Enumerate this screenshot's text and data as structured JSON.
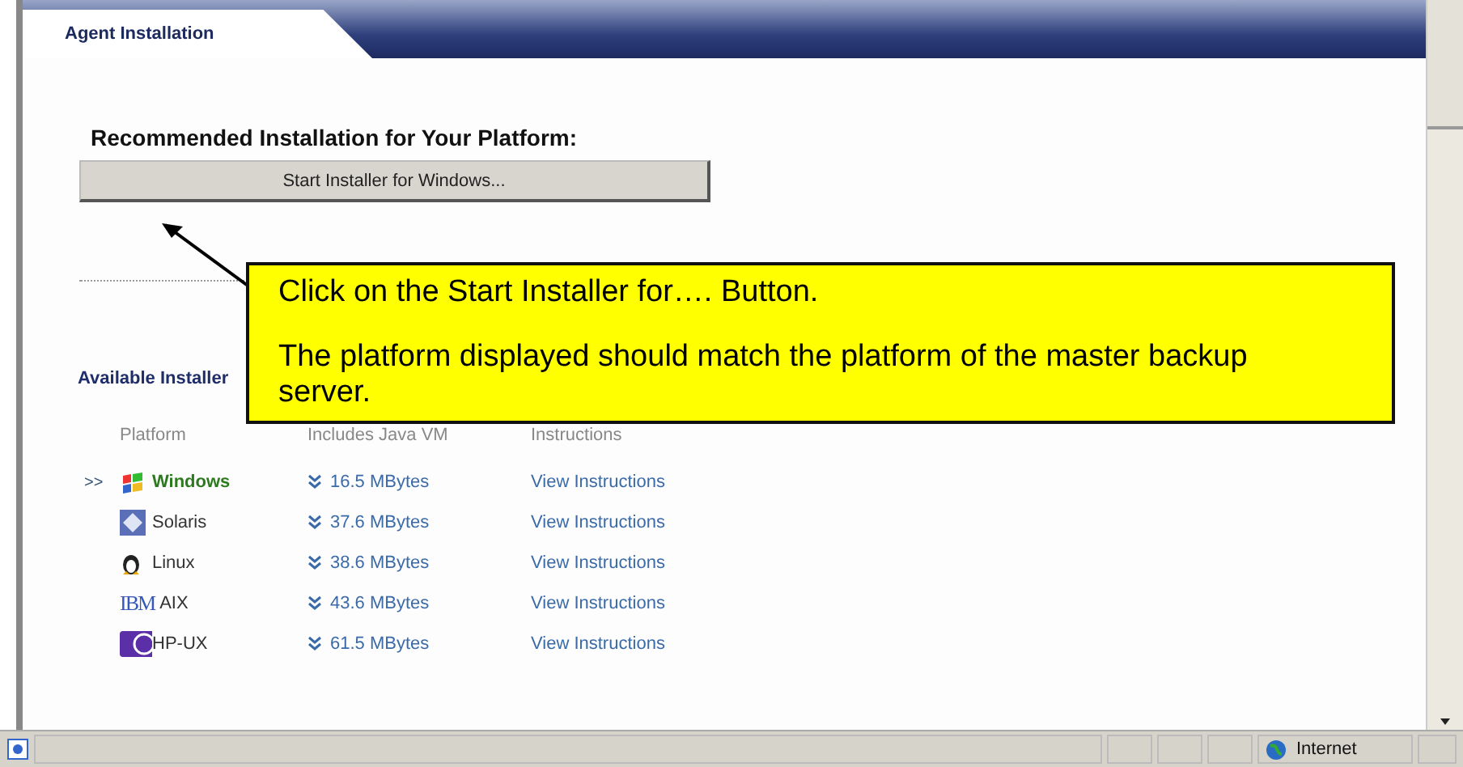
{
  "header": {
    "tab": "Agent Installation"
  },
  "recommended": {
    "heading": "Recommended Installation for Your Platform:",
    "button": "Start Installer for Windows..."
  },
  "available": {
    "heading": "Available Installer"
  },
  "table": {
    "columns": [
      "Platform",
      "Includes Java VM",
      "Instructions"
    ],
    "selected_marker": ">>",
    "rows": [
      {
        "kind": "windows",
        "name": "Windows",
        "size": "16.5 MBytes",
        "link": "View Instructions",
        "selected": true
      },
      {
        "kind": "solaris",
        "name": "Solaris",
        "size": "37.6 MBytes",
        "link": "View Instructions",
        "selected": false
      },
      {
        "kind": "linux",
        "name": "Linux",
        "size": "38.6 MBytes",
        "link": "View Instructions",
        "selected": false
      },
      {
        "kind": "ibm",
        "logo": "IBM",
        "name": "AIX",
        "size": "43.6 MBytes",
        "link": "View Instructions",
        "selected": false
      },
      {
        "kind": "hp",
        "name": "HP-UX",
        "size": "61.5 MBytes",
        "link": "View Instructions",
        "selected": false
      }
    ]
  },
  "callout": {
    "lines": [
      "Click on the Start Installer for…. Button.",
      "The platform displayed should match the platform of the master backup server."
    ]
  },
  "status_bar": {
    "zone": "Internet"
  }
}
